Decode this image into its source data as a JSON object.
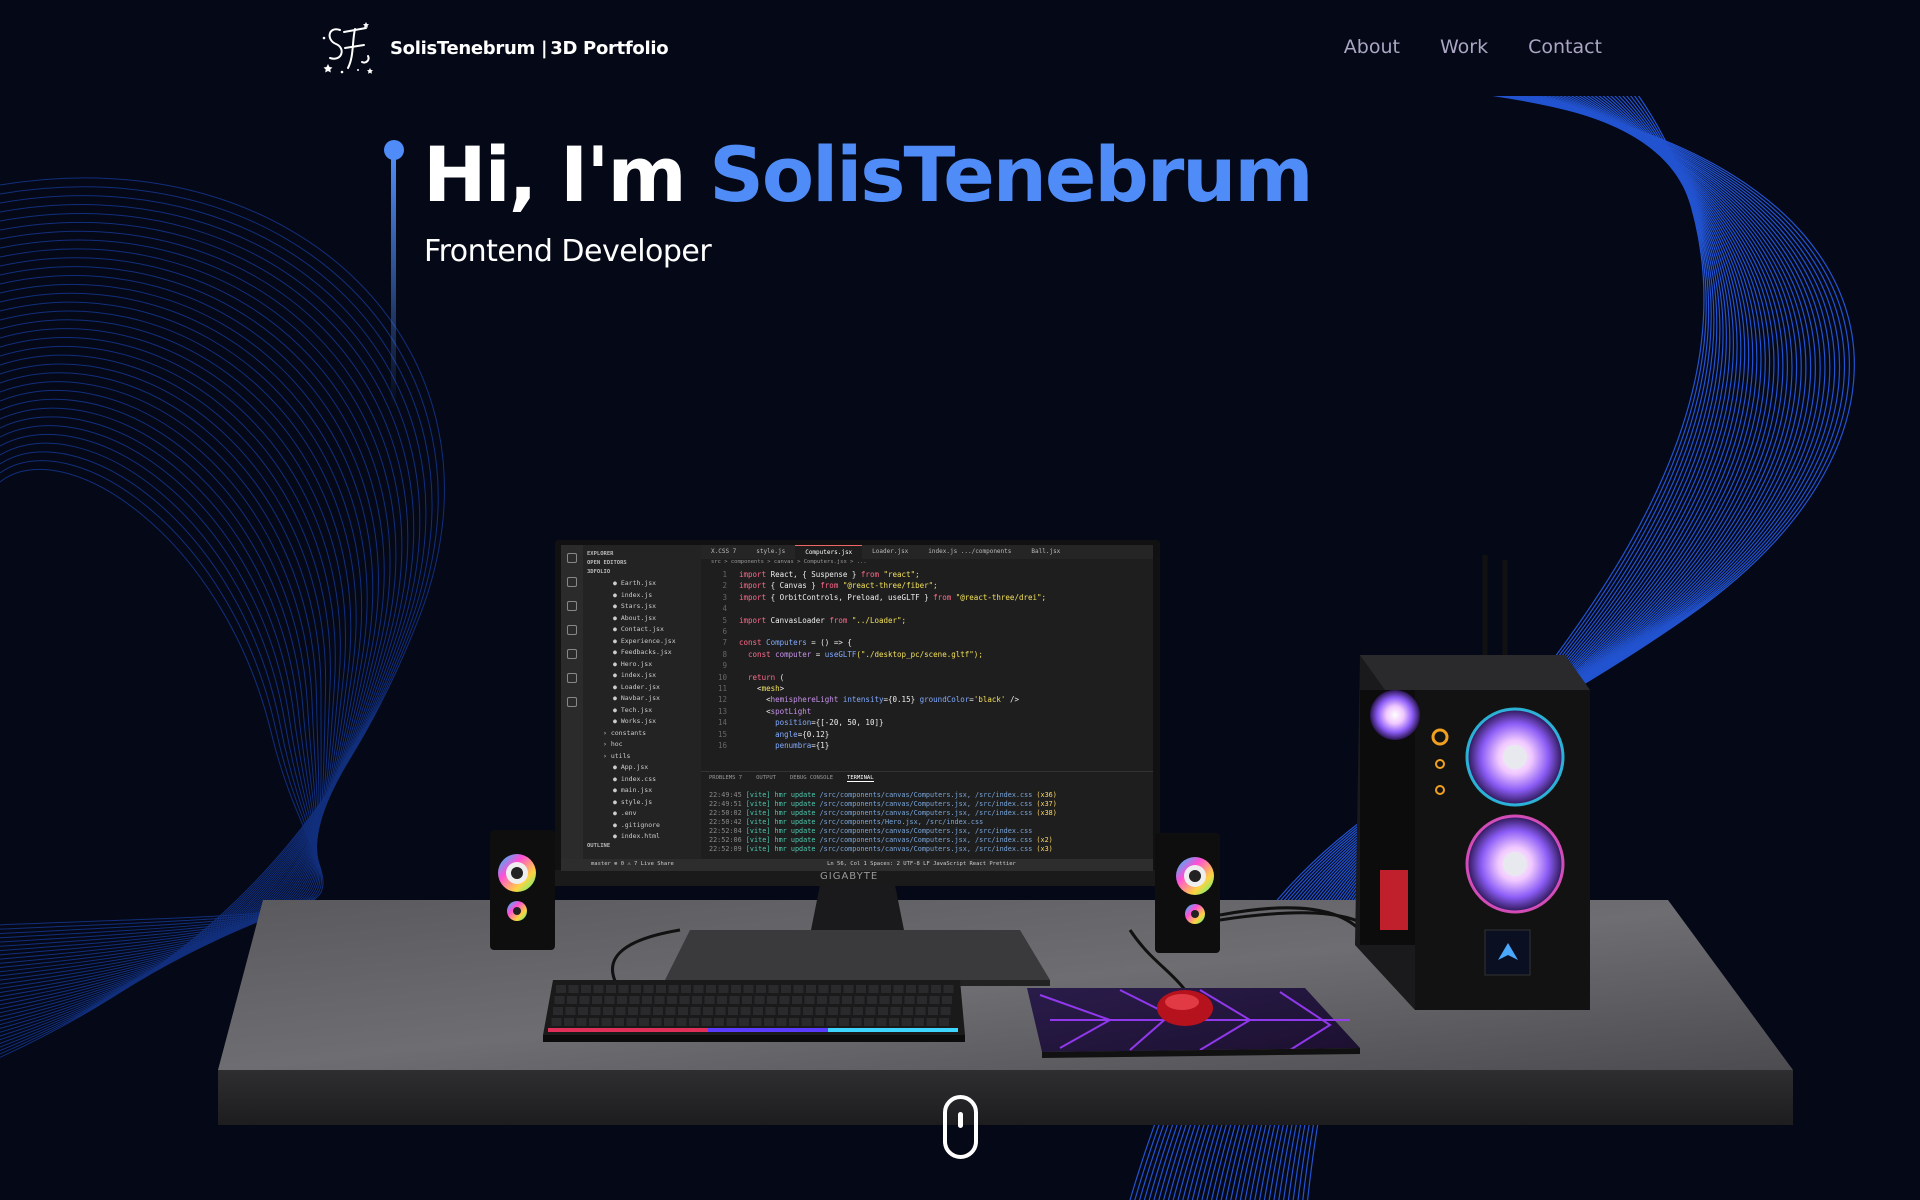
{
  "page": {
    "background": "#050816",
    "accent": "#4f8cf7"
  },
  "navbar": {
    "logo_icon": "st-monogram-logo",
    "brand_name": "SolisTenebrum",
    "brand_separator": "|",
    "brand_tagline": "3D Portfolio",
    "links": [
      {
        "label": "About"
      },
      {
        "label": "Work"
      },
      {
        "label": "Contact"
      }
    ]
  },
  "hero": {
    "greeting": "Hi, I'm ",
    "name": "SolisTenebrum",
    "subtitle": "Frontend Developer"
  },
  "scene": {
    "description_icon": "desktop-pc-3d-model",
    "monitor_brand": "GIGABYTE",
    "editor": {
      "explorer_title": "EXPLORER",
      "open_editors": "OPEN EDITORS",
      "project": "3DFOLIO",
      "files": [
        "Earth.jsx",
        "index.js",
        "Stars.jsx",
        "About.jsx",
        "Contact.jsx",
        "Experience.jsx",
        "Feedbacks.jsx",
        "Hero.jsx",
        "index.jsx",
        "Loader.jsx",
        "Navbar.jsx",
        "Tech.jsx",
        "Works.jsx"
      ],
      "dirs": [
        "constants",
        "hoc",
        "utils"
      ],
      "root_files": [
        "App.jsx",
        "index.css",
        "main.jsx",
        "style.js",
        ".env",
        ".gitignore",
        "index.html"
      ],
      "outline": "OUTLINE",
      "tabs": [
        "X.CSS 7",
        "style.js",
        "Computers.jsx",
        "Loader.jsx",
        "index.js .../components",
        "Ball.jsx"
      ],
      "active_tab": "Computers.jsx",
      "breadcrumb": "src > components > canvas > Computers.jsx > ...",
      "code_lines": [
        {
          "n": "1",
          "parts": [
            [
              "kw",
              "import "
            ],
            [
              "tx",
              "React, { Suspense } "
            ],
            [
              "kw",
              "from "
            ],
            [
              "str",
              "\"react\";"
            ]
          ]
        },
        {
          "n": "2",
          "parts": [
            [
              "kw",
              "import "
            ],
            [
              "tx",
              "{ Canvas } "
            ],
            [
              "kw",
              "from "
            ],
            [
              "str",
              "\"@react-three/fiber\";"
            ]
          ]
        },
        {
          "n": "3",
          "parts": [
            [
              "kw",
              "import "
            ],
            [
              "tx",
              "{ OrbitControls, Preload, useGLTF } "
            ],
            [
              "kw",
              "from "
            ],
            [
              "str",
              "\"@react-three/drei\";"
            ]
          ]
        },
        {
          "n": "4",
          "parts": []
        },
        {
          "n": "5",
          "parts": [
            [
              "kw",
              "import "
            ],
            [
              "tx",
              "CanvasLoader "
            ],
            [
              "kw",
              "from "
            ],
            [
              "str",
              "\"../Loader\";"
            ]
          ]
        },
        {
          "n": "6",
          "parts": []
        },
        {
          "n": "7",
          "parts": [
            [
              "kw",
              "const "
            ],
            [
              "fn",
              "Computers "
            ],
            [
              "tx",
              "= () => {"
            ]
          ]
        },
        {
          "n": "8",
          "parts": [
            [
              "kw",
              "  const "
            ],
            [
              "vr",
              "computer "
            ],
            [
              "tx",
              "= "
            ],
            [
              "fn",
              "useGLTF"
            ],
            [
              "str",
              "(\"./desktop_pc/scene.gltf\");"
            ]
          ]
        },
        {
          "n": "9",
          "parts": []
        },
        {
          "n": "10",
          "parts": [
            [
              "kw",
              "  return "
            ],
            [
              "tx",
              "("
            ]
          ]
        },
        {
          "n": "11",
          "parts": [
            [
              "tx",
              "    <"
            ],
            [
              "str",
              "mesh"
            ],
            [
              "tx",
              ">"
            ]
          ]
        },
        {
          "n": "12",
          "parts": [
            [
              "tx",
              "      <"
            ],
            [
              "vr",
              "hemisphereLight "
            ],
            [
              "fn",
              "intensity"
            ],
            [
              "tx",
              "={0.15} "
            ],
            [
              "fn",
              "groundColor"
            ],
            [
              "tx",
              "="
            ],
            [
              "str",
              "'black' "
            ],
            [
              "tx",
              "/>"
            ]
          ]
        },
        {
          "n": "13",
          "parts": [
            [
              "tx",
              "      <"
            ],
            [
              "vr",
              "spotLight"
            ]
          ]
        },
        {
          "n": "14",
          "parts": [
            [
              "fn",
              "        position"
            ],
            [
              "tx",
              "={[-20, 50, 10]}"
            ]
          ]
        },
        {
          "n": "15",
          "parts": [
            [
              "fn",
              "        angle"
            ],
            [
              "tx",
              "={0.12}"
            ]
          ]
        },
        {
          "n": "16",
          "parts": [
            [
              "fn",
              "        penumbra"
            ],
            [
              "tx",
              "={1}"
            ]
          ]
        }
      ],
      "panel_tabs": [
        "PROBLEMS",
        "OUTPUT",
        "DEBUG CONSOLE",
        "TERMINAL"
      ],
      "problems_count": "7",
      "terminal_lines": [
        {
          "time": "22:49:45",
          "msg": "hmr update",
          "path": "/src/components/canvas/Computers.jsx, /src/index.css",
          "count": "(x36)"
        },
        {
          "time": "22:49:51",
          "msg": "hmr update",
          "path": "/src/components/canvas/Computers.jsx, /src/index.css",
          "count": "(x37)"
        },
        {
          "time": "22:50:02",
          "msg": "hmr update",
          "path": "/src/components/canvas/Computers.jsx, /src/index.css",
          "count": "(x38)"
        },
        {
          "time": "22:50:42",
          "msg": "hmr update",
          "path": "/src/components/Hero.jsx, /src/index.css",
          "count": ""
        },
        {
          "time": "22:52:04",
          "msg": "hmr update",
          "path": "/src/components/canvas/Computers.jsx, /src/index.css",
          "count": ""
        },
        {
          "time": "22:52:06",
          "msg": "hmr update",
          "path": "/src/components/canvas/Computers.jsx, /src/index.css",
          "count": "(x2)"
        },
        {
          "time": "22:52:09",
          "msg": "hmr update",
          "path": "/src/components/canvas/Computers.jsx, /src/index.css",
          "count": "(x3)"
        }
      ],
      "status_left": "master   ⊗ 0 ⚠ 7   Live Share",
      "status_right": "Ln 56, Col 1   Spaces: 2   UTF-8   LF   JavaScript React   Prettier"
    }
  },
  "scroll_indicator": {
    "icon": "mouse-scroll-icon"
  }
}
